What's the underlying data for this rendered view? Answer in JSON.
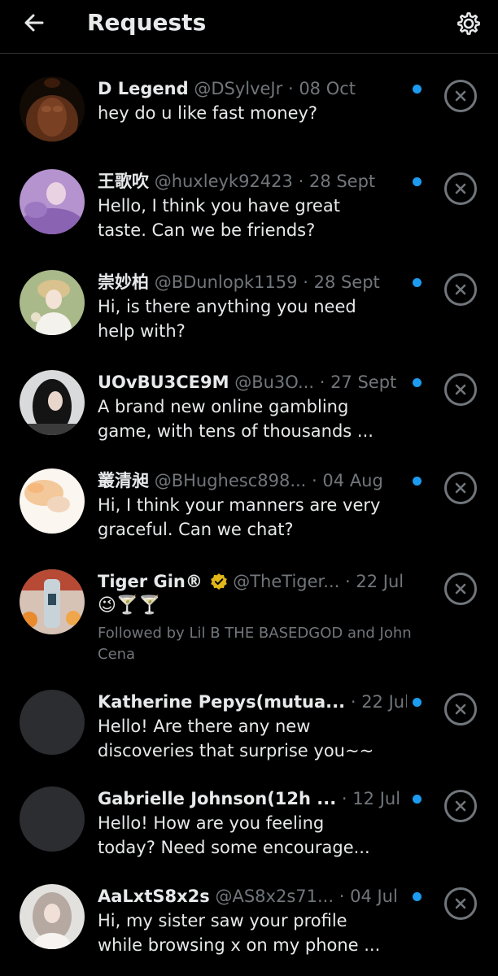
{
  "header": {
    "title": "Requests",
    "back_icon": "arrow-left-icon",
    "settings_icon": "gear-icon"
  },
  "colors": {
    "background": "#000000",
    "text_primary": "#e7e9ea",
    "text_secondary": "#71767b",
    "accent_blue": "#1d9bf0",
    "verified_gold": "#e2b719"
  },
  "requests": [
    {
      "name": "D Legend",
      "handle": "@DSylveJr",
      "sep": "·",
      "date": "08 Oct",
      "message": "hey do u like fast money?"
    },
    {
      "name": "王歌吹",
      "handle": "@huxleyk92423",
      "sep": "·",
      "date": "28 Sept",
      "message": "Hello, I think you have great\ntaste. Can we be friends?"
    },
    {
      "name": "崇妙柏",
      "handle": "@BDunlopk1159",
      "sep": "·",
      "date": "28 Sept",
      "message": "Hi, is there anything you need\nhelp with?"
    },
    {
      "name": "UOvBU3CE9M",
      "handle": "@Bu3O...",
      "sep": "·",
      "date": "27 Sept",
      "message": "A brand new online gambling\ngame, with tens of thousands ..."
    },
    {
      "name": "叢清昶",
      "handle": "@BHughesc898...",
      "sep": "·",
      "date": "04 Aug",
      "message": "Hi, I think your manners are very\ngraceful. Can we chat?"
    },
    {
      "name": "Tiger Gin®",
      "handle": "@TheTiger...",
      "sep": "·",
      "date": "22 Jul",
      "message": "😉🍸🍸",
      "followed_by": "Followed by Lil B THE BASEDGOD and\nJohn Cena"
    },
    {
      "name": "Katherine Pepys(mutua...",
      "handle": "",
      "sep": "·",
      "date": "22 Jul",
      "message": "Hello! Are there any new\ndiscoveries that surprise you~~"
    },
    {
      "name": "Gabrielle Johnson(12h ...",
      "handle": "",
      "sep": "·",
      "date": "12 Jul",
      "message": "Hello! How are you feeling\ntoday? Need some encourage..."
    },
    {
      "name": "AaLxtS8x2s",
      "handle": "@AS8x2s71...",
      "sep": "·",
      "date": "04 Jul",
      "message": "Hi, my sister saw your profile\nwhile browsing x on my phone ..."
    }
  ]
}
